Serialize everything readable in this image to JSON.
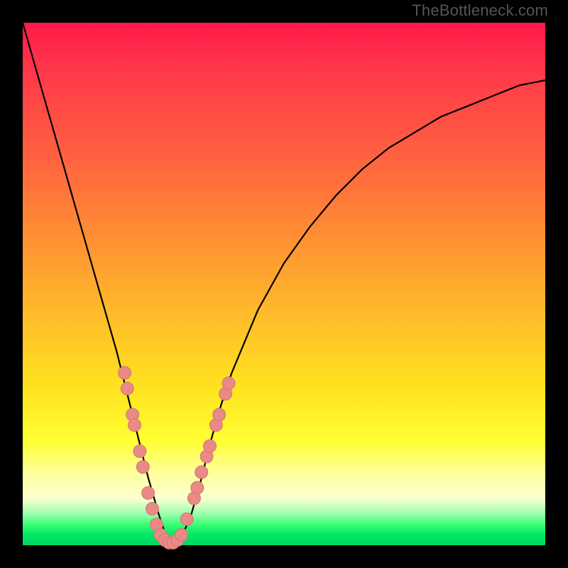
{
  "watermark": "TheBottleneck.com",
  "colors": {
    "frame": "#000000",
    "curve": "#000000",
    "marker_fill": "#e98a86",
    "marker_stroke": "#d07672"
  },
  "chart_data": {
    "type": "line",
    "title": "",
    "xlabel": "",
    "ylabel": "",
    "xlim": [
      0,
      100
    ],
    "ylim": [
      0,
      100
    ],
    "series": [
      {
        "name": "bottleneck-curve",
        "x": [
          0,
          2,
          4,
          6,
          8,
          10,
          12,
          14,
          16,
          18,
          20,
          22,
          24,
          26,
          27,
          28,
          29,
          30,
          32,
          34,
          36,
          38,
          40,
          45,
          50,
          55,
          60,
          65,
          70,
          75,
          80,
          85,
          90,
          95,
          100
        ],
        "y": [
          100,
          93,
          86,
          79,
          72,
          65,
          58,
          51,
          44,
          37,
          29,
          21,
          13,
          6,
          3,
          1,
          0.5,
          1,
          5,
          12,
          20,
          27,
          33,
          45,
          54,
          61,
          67,
          72,
          76,
          79,
          82,
          84,
          86,
          88,
          89
        ]
      }
    ],
    "markers": {
      "name": "data-points",
      "points": [
        {
          "x": 19.5,
          "y": 33
        },
        {
          "x": 20.0,
          "y": 30
        },
        {
          "x": 21.0,
          "y": 25
        },
        {
          "x": 21.4,
          "y": 23
        },
        {
          "x": 22.4,
          "y": 18
        },
        {
          "x": 23.0,
          "y": 15
        },
        {
          "x": 24.0,
          "y": 10
        },
        {
          "x": 24.8,
          "y": 7
        },
        {
          "x": 25.6,
          "y": 4
        },
        {
          "x": 26.4,
          "y": 2
        },
        {
          "x": 27.2,
          "y": 1
        },
        {
          "x": 28.0,
          "y": 0.5
        },
        {
          "x": 28.8,
          "y": 0.5
        },
        {
          "x": 29.6,
          "y": 1
        },
        {
          "x": 30.4,
          "y": 2
        },
        {
          "x": 31.4,
          "y": 5
        },
        {
          "x": 32.8,
          "y": 9
        },
        {
          "x": 33.4,
          "y": 11
        },
        {
          "x": 34.2,
          "y": 14
        },
        {
          "x": 35.2,
          "y": 17
        },
        {
          "x": 35.8,
          "y": 19
        },
        {
          "x": 37.0,
          "y": 23
        },
        {
          "x": 37.6,
          "y": 25
        },
        {
          "x": 38.8,
          "y": 29
        },
        {
          "x": 39.4,
          "y": 31
        }
      ]
    }
  }
}
